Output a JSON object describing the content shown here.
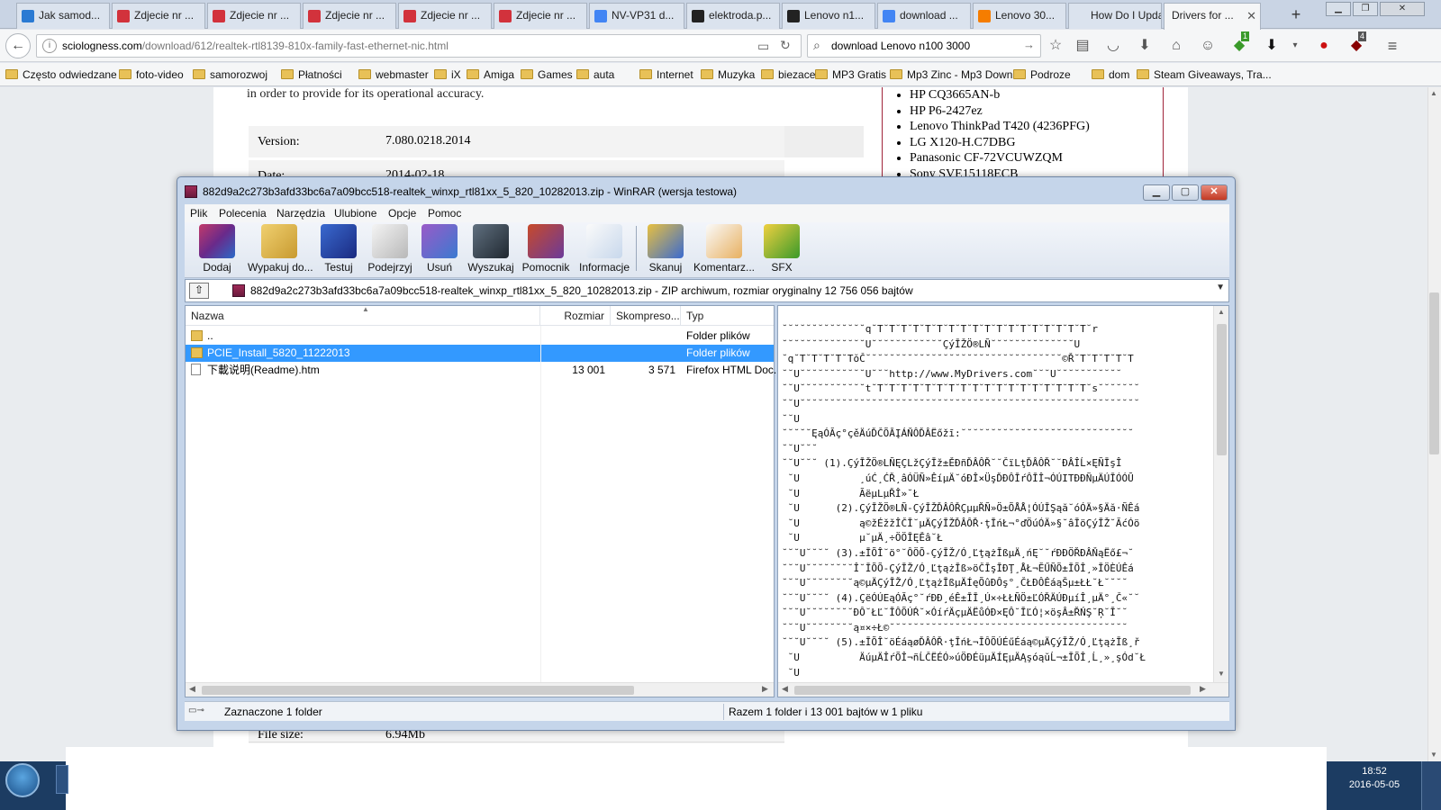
{
  "browser": {
    "tabs": [
      {
        "label": "Jak samod...",
        "icon": "c-site-icon",
        "color": "#2a7ad3"
      },
      {
        "label": "Zdjecie nr ...",
        "icon": "photo-site-icon",
        "color": "#d2323c"
      },
      {
        "label": "Zdjecie nr ...",
        "icon": "photo-site-icon",
        "color": "#d2323c"
      },
      {
        "label": "Zdjecie nr ...",
        "icon": "photo-site-icon",
        "color": "#d2323c"
      },
      {
        "label": "Zdjecie nr ...",
        "icon": "photo-site-icon",
        "color": "#d2323c"
      },
      {
        "label": "Zdjecie nr ...",
        "icon": "photo-site-icon",
        "color": "#d2323c"
      },
      {
        "label": "NV-VP31 d...",
        "icon": "google-icon",
        "color": "#4285f4"
      },
      {
        "label": "elektroda.p...",
        "icon": "e-site-icon",
        "color": "#222222"
      },
      {
        "label": "Lenovo n1...",
        "icon": "e-site-icon",
        "color": "#222222"
      },
      {
        "label": "download ...",
        "icon": "google-icon",
        "color": "#4285f4"
      },
      {
        "label": "Lenovo 30...",
        "icon": "blogger-icon",
        "color": "#f57d00"
      },
      {
        "label": "How Do I Upda...",
        "icon": "blank-page-icon",
        "color": "#dbe3ee"
      },
      {
        "label": "Drivers for ...",
        "icon": "none",
        "color": "#f5f6f7"
      }
    ],
    "new_tab": "+",
    "url_host": "sciologness.com",
    "url_path": "/download/612/realtek-rtl8139-810x-family-fast-ethernet-nic.html",
    "search_value": "download Lenovo n100 3000",
    "badge_green": "1",
    "badge_red": "4",
    "bookmarks": [
      "Często odwiedzane",
      "foto-video",
      "samorozwoj",
      "Płatności",
      "webmaster",
      "iX",
      "Amiga",
      "Games",
      "auta",
      "Internet",
      "Muzyka",
      "biezace",
      "MP3 Gratis",
      "Mp3 Zinc - Mp3 Down...",
      "Podroze",
      "dom",
      "Steam Giveaways, Tra..."
    ]
  },
  "page": {
    "intro_line": "in order to provide for its operational accuracy.",
    "version_label": "Version:",
    "version_value": "7.080.0218.2014",
    "date_label": "Date:",
    "date_value": "2014-02-18",
    "filesize_label": "File size:",
    "filesize_value": "6.94Mb",
    "compatible": [
      "HP CQ3665AN-b",
      "HP P6-2427ez",
      "Lenovo ThinkPad T420 (4236PFG)",
      "LG X120-H.C7DBG",
      "Panasonic CF-72VCUWZQM",
      "Sony SVE15118ECB"
    ]
  },
  "winrar": {
    "title": "882d9a2c273b3afd33bc6a7a09bcc518-realtek_winxp_rtl81xx_5_820_10282013.zip - WinRAR (wersja testowa)",
    "menu": [
      "Plik",
      "Polecenia",
      "Narzędzia",
      "Ulubione",
      "Opcje",
      "Pomoc"
    ],
    "toolbar": [
      {
        "label": "Dodaj",
        "icon": "add-archive-icon"
      },
      {
        "label": "Wypakuj do...",
        "icon": "extract-folder-icon"
      },
      {
        "label": "Testuj",
        "icon": "test-archive-icon"
      },
      {
        "label": "Podejrzyj",
        "icon": "view-glasses-icon"
      },
      {
        "label": "Usuń",
        "icon": "delete-recycle-icon"
      },
      {
        "label": "Wyszukaj",
        "icon": "find-binoculars-icon"
      },
      {
        "label": "Pomocnik",
        "icon": "wizard-icon"
      },
      {
        "label": "Informacje",
        "icon": "info-icon"
      },
      {
        "label": "Skanuj",
        "icon": "virus-scan-icon"
      },
      {
        "label": "Komentarz...",
        "icon": "comment-icon"
      },
      {
        "label": "SFX",
        "icon": "sfx-icon"
      }
    ],
    "path": "882d9a2c273b3afd33bc6a7a09bcc518-realtek_winxp_rtl81xx_5_820_10282013.zip - ZIP archiwum, rozmiar oryginalny 12 756 056 bajtów",
    "columns": [
      "Nazwa",
      "Rozmiar",
      "Skompreso...",
      "Typ"
    ],
    "files": [
      {
        "name": "..",
        "size": "",
        "packed": "",
        "type": "Folder plików",
        "kind": "folder",
        "selected": false
      },
      {
        "name": "PCIE_Install_5820_11222013",
        "size": "",
        "packed": "",
        "type": "Folder plików",
        "kind": "folder",
        "selected": true
      },
      {
        "name": "下載说明(Readme).htm",
        "size": "13 001",
        "packed": "3 571",
        "type": "Firefox HTML Doc...",
        "kind": "doc",
        "selected": false
      }
    ],
    "viewer_lines": [
      "˘˘˘˘˘˘˘˘˘˘˘˘˘˘q˘T˘T˘T˘T˘T˘T˘T˘T˘T˘T˘T˘T˘T˘T˘T˘T˘T˘T˘r",
      "˘˘˘˘˘˘˘˘˘˘˘˘˘˘U˘˘˘˘˘˘˘˘˘˘˘˘ÇýĪŽÖ®LÑ˘˘˘˘˘˘˘˘˘˘˘˘˘˘U",
      "˘q˘T˘T˘T˘T˘TŏČ˘˘˘˘˘˘˘˘˘˘˘˘˘˘˘˘˘˘˘˘˘˘˘˘˘˘˘˘˘˘˘˘˘©Ř˘T˘T˘T˘T˘T",
      "˘˘U˘˘˘˘˘˘˘˘˘˘˘U˘˘˘http://www.MyDrivers.com˘˘˘U˘˘˘˘˘˘˘˘˘˘˘",
      "˘˘U˘˘˘˘˘˘˘˘˘˘˘t˘T˘T˘T˘T˘T˘T˘T˘T˘T˘T˘T˘T˘T˘T˘T˘T˘T˘T˘s˘˘˘˘˘˘˘",
      "˘˘U˘˘˘˘˘˘˘˘˘˘˘˘˘˘˘˘˘˘˘˘˘˘˘˘˘˘˘˘˘˘˘˘˘˘˘˘˘˘˘˘˘˘˘˘˘˘˘˘˘˘˘˘˘˘˘˘˘",
      "˘˘U",
      "˘˘˘˘˘ĘąÓĂç°çěÄúĎČÕĀĮÁŇÔĎÂËőžī:˘˘˘˘˘˘˘˘˘˘˘˘˘˘˘˘˘˘˘˘˘˘˘˘˘˘˘˘˘",
      "˘˘U˘˘˘",
      "˘˘U˘˘˘ (1).ÇýĪŽÖ®LÑĘÇLžÇýĪž±ĚÐñĎÂÔŘ˘˘ČïLţĎÂÔŘ˘˘ĐÂÎĹ×ĘÑĪşÎ",
      " ˘U          ¸úĆ¸ĆŘ¸âÓÜÑ»ÊíµÄ˘óĐÎ×ÜşĎĐÔĪŕÔĪÎ¬ÓÚITĐĐÑµÄÚĪÓÓŪ",
      " ˘U          ÃëµLµŘÎ»˘Ł",
      " ˘U      (2).ÇýĪŽÖ®LÑ-ÇýĪŽĎÂÔŘÇµµŘÑ»Ö±ÕÅÅ¦ÓÚĪŞąă˘óÓÄ»§Äă·ÑÊá",
      " ˘U          ą©žÉžžÎČĪ˘µÄÇýĪŽĎÂÔŘ·ţĪńŁ¬°ďÖúÓÄ»§˘âĪöÇýĪŽ˘ĂćÓö",
      " ˘U          µ˘µÄ¸÷ÖÖĪĘĚâ˘Ł",
      "˘˘˘U˘˘˘˘ (3).±ĪÕÎ˘ö°˘ÔÖÕ-ÇýĪŽ/Ó¸ĽţążĪßµÄ¸ńĘ˘˘ŕĐĐÖŘĐÂŇąËő£¬˘",
      "˘˘˘U˘˘˘˘˘˘˘˘Î˘ĪÕÕ-ÇýĪŽ/Ó¸ĽţążĪß»öČĪşĪĐŢ¸ÅŁ¬ĔŰÑÕ±ĪÕÎ¸»ĪÖÈÚÊá",
      "˘˘˘U˘˘˘˘˘˘˘˘ą©µÄÇýĪŽ/Ó¸ĽţążĪßµÄÍęÕûĐÔş°¸ČŁĐÔÊáąŠµ±ŁŁ˘Ł˘˘˘˘",
      "˘˘˘U˘˘˘˘ (4).ÇëÓÚEąÓĂç°˘ŕĐĐ¸éÊ±ĪĪ¸Ú×÷ŁŁÑÖ±ĽÓŘÄÚĐµíÎ¸µÄ°¸Č«˘˘",
      "˘˘˘U˘˘˘˘˘˘˘˘ĐÔ˘ŁĽ˘ĪÔÕÚŔ˘×ÓíŕÄçµÄËůÓÐ×ĘÔ˘ĪĽÓ¦×öşÂ±ŘŃŞ˘Ŗ˘Ī˘˘",
      "˘˘˘U˘˘˘˘˘˘˘˘ą¤×÷Ł©˘˘˘˘˘˘˘˘˘˘˘˘˘˘˘˘˘˘˘˘˘˘˘˘˘˘˘˘˘˘˘˘˘˘˘˘˘˘˘˘",
      "˘˘˘U˘˘˘˘ (5).±ĪÕÎ˘öÉáąøĎÂÔŘ·ţĪńŁ¬ĪÔÕÚÉűÉáą©µÄÇýĪŽ/Ó¸ĽţążĪß¸ř",
      " ˘U          ÄúµÄÎŕÕÎ¬ñĹČËÉÓ»úÖĐÉüµÄÍĘµÄĄşóąŭĹ¬±ĪÕÎ¸Ĺ¸»¸şÓd˘Ł",
      " ˘U"
    ],
    "status_left": "Zaznaczone 1 folder",
    "status_right": "Razem 1 folder i 13 001 bajtów w 1 pliku"
  },
  "taskbar": {
    "time": "18:52",
    "date": "2016-05-05"
  }
}
